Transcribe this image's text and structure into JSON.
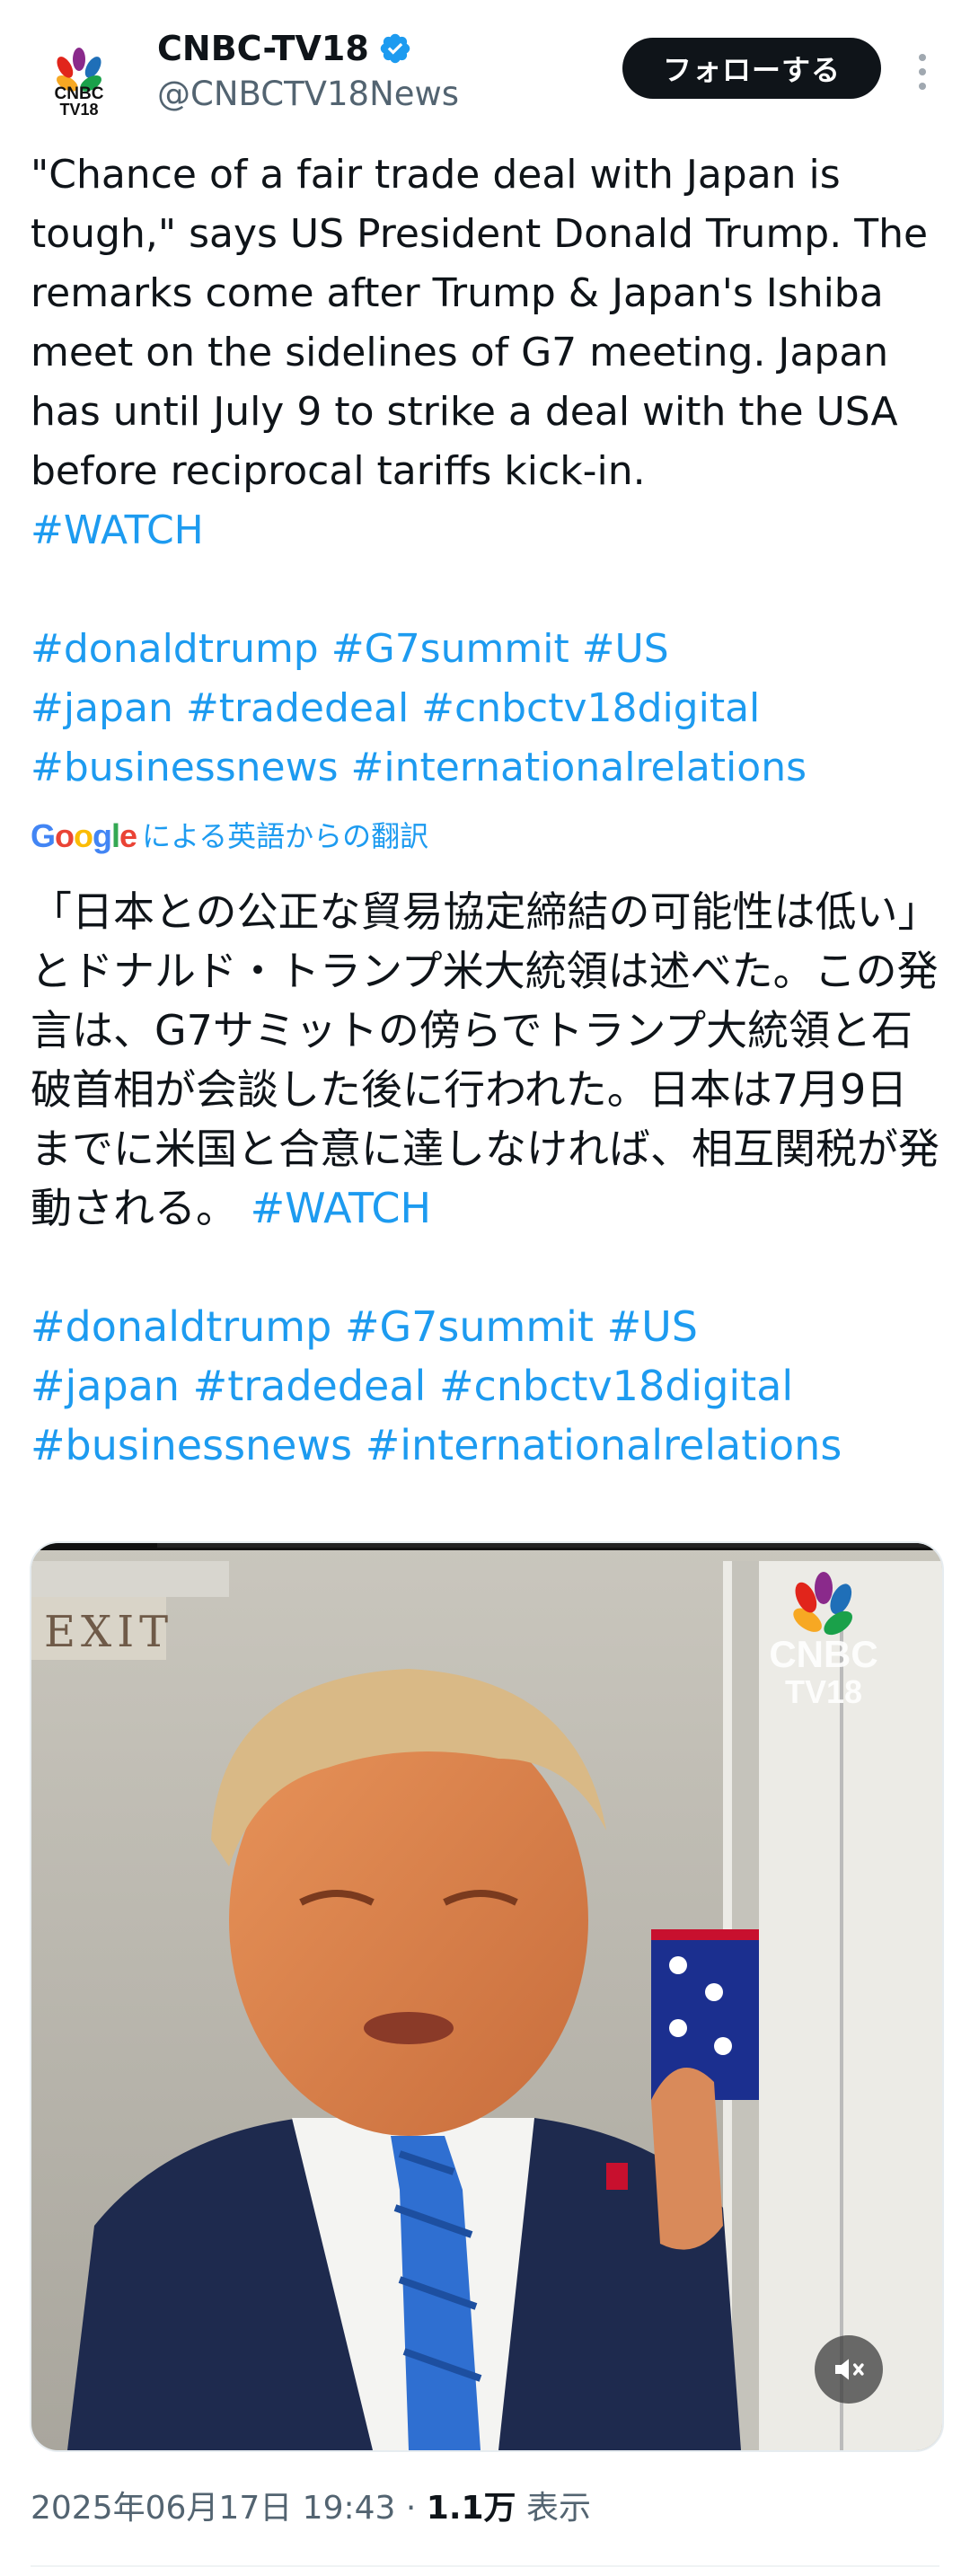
{
  "account": {
    "display_name": "CNBC-TV18",
    "handle": "@CNBCTV18News",
    "verified": true,
    "follow_label": "フォローする",
    "avatar_text_line1": "CNBC",
    "avatar_text_line2": "TV18"
  },
  "tweet": {
    "body": "\"Chance of a fair trade deal with Japan is tough,\" says US President Donald Trump. The remarks come after Trump & Japan's Ishiba meet on the sidelines of G7 meeting. Japan has until July 9 to strike a deal with the USA before reciprocal tariffs kick-in.",
    "tag_watch": "#WATCH",
    "hashtags_line1": "#donaldtrump #G7summit #US",
    "hashtags_line2": "#japan #tradedeal #cnbctv18digital",
    "hashtags_line3": "#businessnews #internationalrelations"
  },
  "translation": {
    "google_label": "Google",
    "label": "による英語からの翻訳",
    "body": "「日本との公正な貿易協定締結の可能性は低い」とドナルド・トランプ米大統領は述べた。この発言は、G7サミットの傍らでトランプ大統領と石破首相が会談した後に行われた。日本は7月9日までに米国と合意に達しなければ、相互関税が発動される。",
    "tag_watch": "#WATCH",
    "hashtags_line1": "#donaldtrump #G7summit #US",
    "hashtags_line2": "#japan #tradedeal #cnbctv18digital",
    "hashtags_line3": "#businessnews #internationalrelations"
  },
  "media": {
    "exit_sign": "EXIT",
    "watermark_line1": "CNBC",
    "watermark_line2": "TV18",
    "mute_icon": "speaker-muted-icon"
  },
  "meta": {
    "timestamp": "2025年06月17日 19:43",
    "separator": " · ",
    "views_count": "1.1万",
    "views_label": " 表示"
  },
  "colors": {
    "link": "#1d9bf0",
    "text": "#0f1419",
    "secondary": "#536471",
    "follow_bg": "#0f1419"
  }
}
